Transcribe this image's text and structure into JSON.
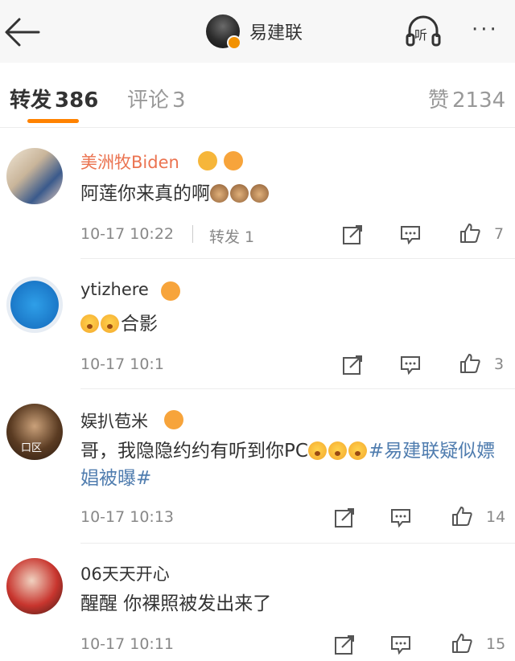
{
  "header": {
    "title": "易建联",
    "listen_label": "听",
    "more_label": "···"
  },
  "tabs": [
    {
      "label": "转发",
      "count": "386"
    },
    {
      "label": "评论",
      "count": "3"
    },
    {
      "label": "赞",
      "count": "2134"
    }
  ],
  "comments": [
    {
      "name": "美洲牧Biden",
      "content_text": "阿莲你来真的啊",
      "content_emoji": [
        "monkey",
        "monkey",
        "monkey"
      ],
      "time": "10-17 10:22",
      "repost_label": "转发 1",
      "likes": "7"
    },
    {
      "name": "ytizhere",
      "content_emoji": [
        "surprised",
        "surprised"
      ],
      "content_text": "合影",
      "time": "10-17 10:1",
      "likes": "3"
    },
    {
      "name": "娱扒苞米",
      "avatar_label": "口区",
      "content_text": "哥，我隐隐约约有听到你PC",
      "content_emoji": [
        "shy",
        "shy",
        "shy"
      ],
      "topic": "#易建联疑似嫖娼被曝#",
      "time": "10-17 10:13",
      "likes": "14"
    },
    {
      "name": "06天天开心",
      "content_text": "醒醒 你裸照被发出来了",
      "time": "10-17 10:11",
      "likes": "15"
    }
  ],
  "colors": {
    "accent": "#ff8200",
    "name_vip": "#eb7350",
    "topic": "#507daf"
  }
}
